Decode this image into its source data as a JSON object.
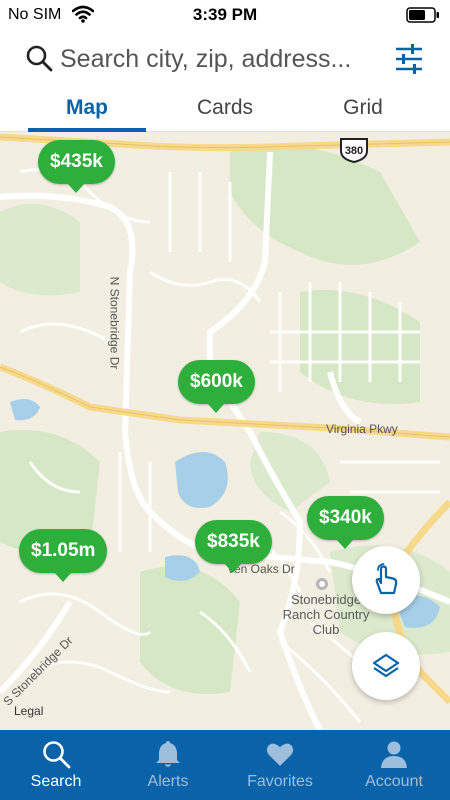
{
  "status_bar": {
    "carrier": "No SIM",
    "time": "3:39 PM"
  },
  "search": {
    "placeholder": "Search city, zip, address..."
  },
  "tabs": [
    {
      "label": "Map",
      "active": true
    },
    {
      "label": "Cards",
      "active": false
    },
    {
      "label": "Grid",
      "active": false
    }
  ],
  "map": {
    "pins": [
      {
        "price": "$435k"
      },
      {
        "price": "$600k"
      },
      {
        "price": "$340k"
      },
      {
        "price": "$835k"
      },
      {
        "price": "$1.05m"
      }
    ],
    "labels": {
      "road_virginia": "Virginia Pkwy",
      "road_stonebridge_north": "N Stonebridge Dr",
      "road_stonebridge_south": "S Stonebridge Dr",
      "road_oaks": "ven Oaks Dr",
      "poi_name": "Stonebridge Ranch Country Club",
      "highway": "380",
      "legal": "Legal"
    },
    "pin_color": "#2eae3b"
  },
  "bottom_nav": [
    {
      "label": "Search",
      "icon": "search-icon",
      "active": true
    },
    {
      "label": "Alerts",
      "icon": "bell-icon",
      "active": false
    },
    {
      "label": "Favorites",
      "icon": "heart-icon",
      "active": false
    },
    {
      "label": "Account",
      "icon": "person-icon",
      "active": false
    }
  ],
  "colors": {
    "brand": "#0a63a8",
    "pin": "#2eae3b",
    "map_bg": "#f3eee2"
  }
}
